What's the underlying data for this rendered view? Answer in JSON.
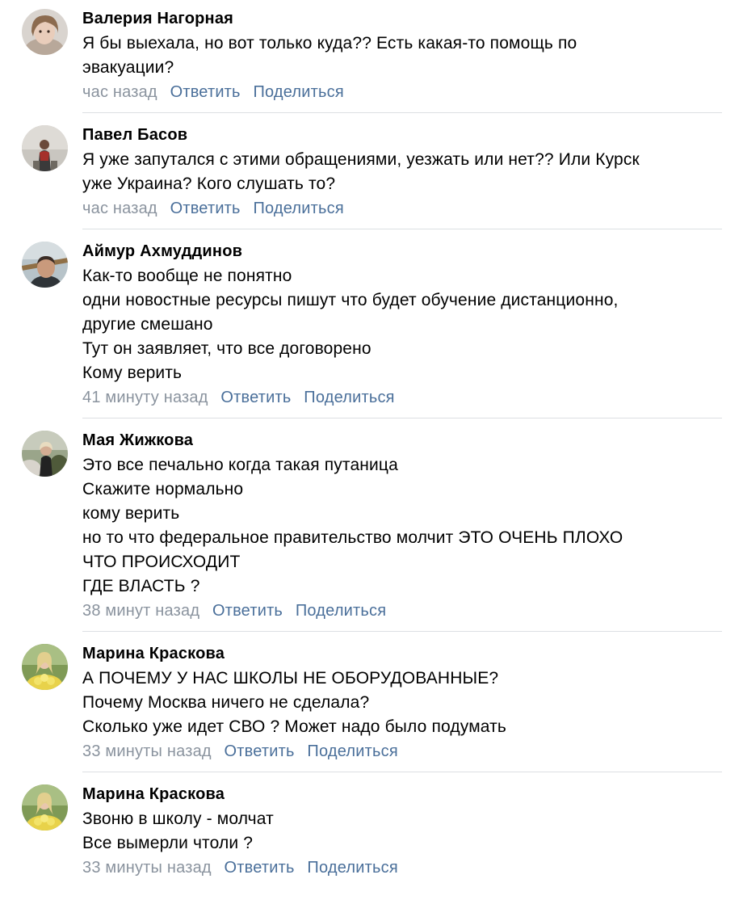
{
  "actions": {
    "reply": "Ответить",
    "share": "Поделиться"
  },
  "comments": [
    {
      "author": "Валерия Нагорная",
      "lines": [
        "Я бы выехала, но вот только куда?? Есть какая-то помощь по",
        "эвакуации?"
      ],
      "time": "час назад"
    },
    {
      "author": "Павел Басов",
      "lines": [
        "Я уже запутался с этими обращениями, уезжать или нет?? Или Курск",
        "уже Украина? Кого слушать то?"
      ],
      "time": "час назад"
    },
    {
      "author": "Аймур Ахмуддинов",
      "lines": [
        "Как-то вообще не понятно",
        "одни новостные ресурсы пишут что будет обучение дистанционно,",
        "другие смешано",
        "Тут он заявляет, что все договорено",
        "Кому верить"
      ],
      "time": "41 минуту назад"
    },
    {
      "author": "Мая Жижкова",
      "lines": [
        "Это все печально когда такая путаница",
        "Скажите нормально",
        "кому верить",
        "но то что федеральное правительство молчит ЭТО ОЧЕНЬ ПЛОХО",
        "ЧТО ПРОИСХОДИТ",
        "ГДЕ ВЛАСТЬ ?"
      ],
      "time": "38 минут назад"
    },
    {
      "author": "Марина Краскова",
      "lines": [
        "А ПОЧЕМУ У НАС ШКОЛЫ НЕ ОБОРУДОВАННЫЕ?",
        "Почему Москва ничего не сделала?",
        "Сколько уже идет СВО ? Может надо было подумать"
      ],
      "time": "33 минуты назад"
    },
    {
      "author": "Марина Краскова",
      "lines": [
        "Звоню в школу - молчат",
        "Все вымерли чтоли ?"
      ],
      "time": "33 минуты назад"
    }
  ]
}
